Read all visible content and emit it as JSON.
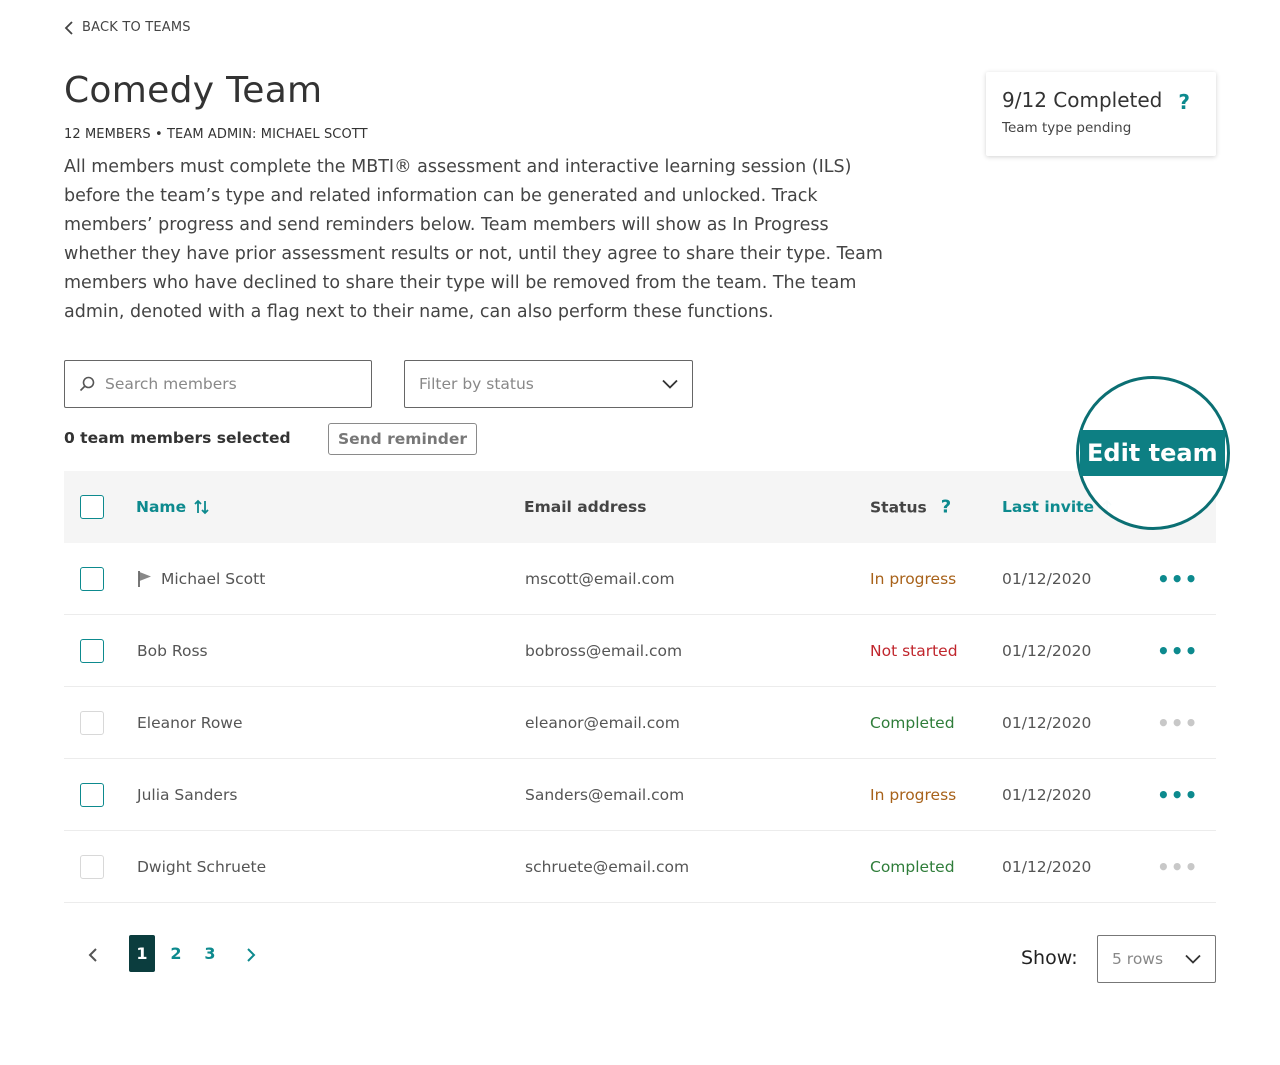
{
  "nav": {
    "back_label": "BACK TO TEAMS"
  },
  "team": {
    "title": "Comedy Team",
    "meta": "12 MEMBERS • TEAM ADMIN: MICHAEL SCOTT",
    "description": "All members must complete the MBTI® assessment and interactive learning session (ILS) before the team’s type and related information can be generated and unlocked. Track members’ progress and send reminders below. Team members will show as In Progress whether they have prior assessment results or not, until they agree to share their type. Team members who have declined to share their type will be removed from the team. The team admin, denoted with a flag next to their name, can also perform these functions."
  },
  "progress_card": {
    "title": "9/12 Completed",
    "help": "?",
    "subtitle": "Team type pending",
    "completed_fraction": 0.75
  },
  "search": {
    "placeholder": "Search members",
    "icon": "search-icon"
  },
  "filter": {
    "placeholder": "Filter by status"
  },
  "selection": {
    "count_text": "0 team members selected",
    "send_label": "Send reminder"
  },
  "edit_team": {
    "label": "Edit team"
  },
  "table": {
    "headers": {
      "name": "Name",
      "email": "Email address",
      "status": "Status",
      "status_help": "?",
      "last_invite": "Last invite"
    },
    "rows": [
      {
        "name": "Michael Scott",
        "admin": true,
        "email": "mscott@email.com",
        "status": "In progress",
        "date": "01/12/2020",
        "more": "•••",
        "selectable": true
      },
      {
        "name": "Bob Ross",
        "admin": false,
        "email": "bobross@email.com",
        "status": "Not started",
        "date": "01/12/2020",
        "more": "•••",
        "selectable": true
      },
      {
        "name": "Eleanor Rowe",
        "admin": false,
        "email": "eleanor@email.com",
        "status": "Completed",
        "date": "01/12/2020",
        "more": "•••",
        "selectable": false
      },
      {
        "name": "Julia Sanders",
        "admin": false,
        "email": "Sanders@email.com",
        "status": "In progress",
        "date": "01/12/2020",
        "more": "•••",
        "selectable": true
      },
      {
        "name": "Dwight Schruete",
        "admin": false,
        "email": "schruete@email.com",
        "status": "Completed",
        "date": "01/12/2020",
        "more": "•••",
        "selectable": false
      }
    ]
  },
  "pagination": {
    "pages": [
      "1",
      "2",
      "3"
    ],
    "current": "1"
  },
  "show": {
    "label": "Show:",
    "value": "5 rows"
  },
  "colors": {
    "accent": "#0d8a8e",
    "accent_dark": "#0b3d3e",
    "in_progress": "#a8621a",
    "not_started": "#c0262d",
    "completed": "#2f7d3a",
    "disabled": "#c8c8c8"
  }
}
